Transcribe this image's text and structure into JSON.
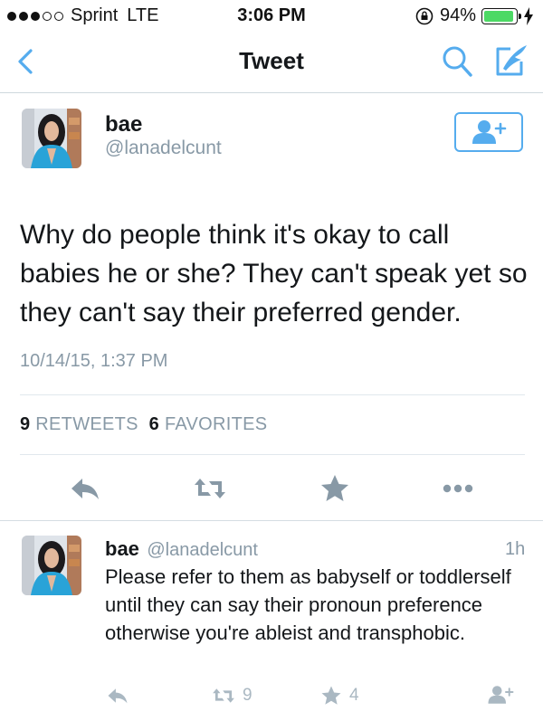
{
  "status_bar": {
    "carrier": "Sprint",
    "network": "LTE",
    "time": "3:06 PM",
    "battery": "94%",
    "battery_level": 0.94,
    "signal_bars_filled": 3,
    "signal_bars_total": 5
  },
  "nav": {
    "title": "Tweet",
    "back_icon": "chevron-left-icon",
    "search_icon": "search-icon",
    "compose_icon": "compose-icon"
  },
  "tweet": {
    "name": "bae",
    "handle": "@lanadelcunt",
    "text": "Why do people think it's okay to call babies he or she? They can't speak yet so they can't say their preferred gender.",
    "timestamp": "10/14/15, 1:37 PM",
    "retweets_count": "9",
    "retweets_label": "RETWEETS",
    "favorites_count": "6",
    "favorites_label": "FAVORITES"
  },
  "reply": {
    "name": "bae",
    "handle": "@lanadelcunt",
    "age": "1h",
    "text": "Please refer to them as babyself or toddlerself until they can say their pronoun preference otherwise you're ableist and transphobic.",
    "retweets": "9",
    "favorites": "4"
  },
  "colors": {
    "accent": "#55acee",
    "muted": "#8899a6",
    "icon_muted": "#aab8c2",
    "battery": "#4cd964"
  }
}
